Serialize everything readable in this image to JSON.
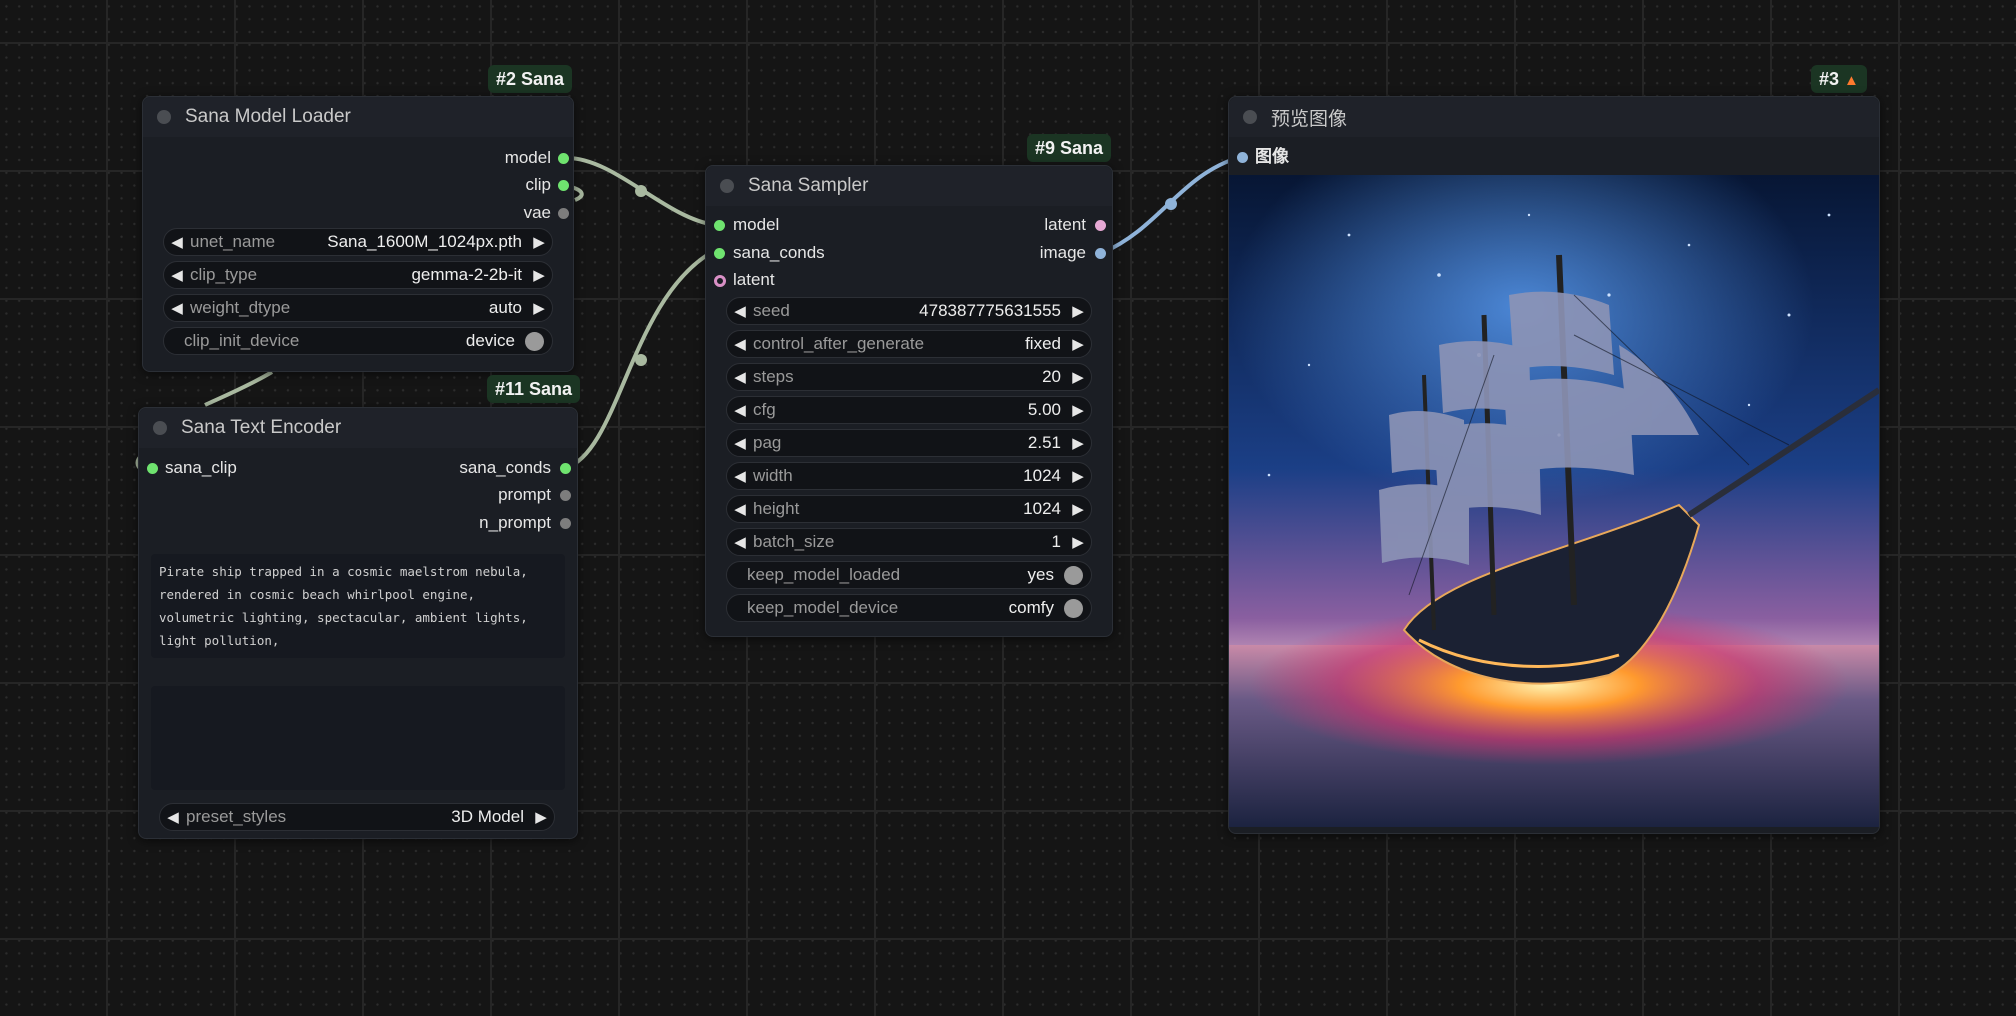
{
  "nodes": {
    "model_loader": {
      "badge": "#2 Sana",
      "title": "Sana Model Loader",
      "outputs": [
        "model",
        "clip",
        "vae"
      ],
      "widgets": [
        {
          "label": "unet_name",
          "value": "Sana_1600M_1024px.pth"
        },
        {
          "label": "clip_type",
          "value": "gemma-2-2b-it"
        },
        {
          "label": "weight_dtype",
          "value": "auto"
        }
      ],
      "toggle": {
        "label": "clip_init_device",
        "value": "device"
      }
    },
    "text_encoder": {
      "badge": "#11 Sana",
      "title": "Sana Text Encoder",
      "input": "sana_clip",
      "outputs": [
        "sana_conds",
        "prompt",
        "n_prompt"
      ],
      "prompt_text": "Pirate ship trapped in a cosmic maelstrom nebula, rendered in cosmic beach whirlpool engine, volumetric lighting, spectacular, ambient lights, light pollution,",
      "negative_text": "",
      "preset": {
        "label": "preset_styles",
        "value": "3D Model"
      }
    },
    "sampler": {
      "badge": "#9 Sana",
      "title": "Sana Sampler",
      "inputs": [
        "model",
        "sana_conds",
        "latent"
      ],
      "outputs": [
        "latent",
        "image"
      ],
      "widgets": [
        {
          "label": "seed",
          "value": "478387775631555"
        },
        {
          "label": "control_after_generate",
          "value": "fixed"
        },
        {
          "label": "steps",
          "value": "20"
        },
        {
          "label": "cfg",
          "value": "5.00"
        },
        {
          "label": "pag",
          "value": "2.51"
        },
        {
          "label": "width",
          "value": "1024"
        },
        {
          "label": "height",
          "value": "1024"
        },
        {
          "label": "batch_size",
          "value": "1"
        }
      ],
      "toggles": [
        {
          "label": "keep_model_loaded",
          "value": "yes"
        },
        {
          "label": "keep_model_device",
          "value": "comfy"
        }
      ]
    },
    "preview": {
      "badge": "#3",
      "badge_icon": "fox-icon",
      "title": "预览图像",
      "input": "图像"
    }
  },
  "colors": {
    "link_model": "#a9b9a0",
    "link_image": "#8fb3d9",
    "slot_green": "#6fe36f",
    "badge_bg": "#1b3523"
  }
}
